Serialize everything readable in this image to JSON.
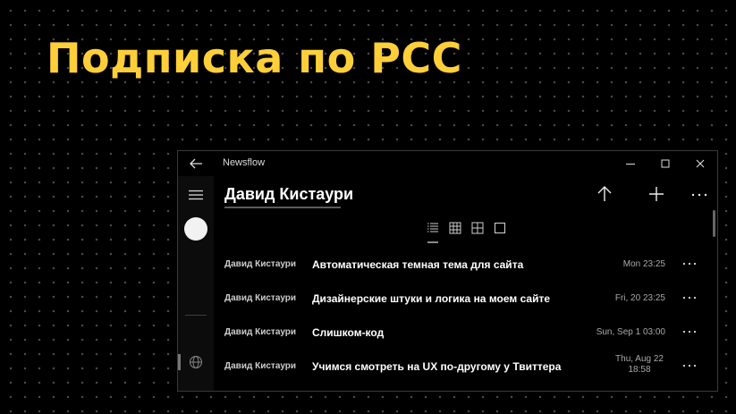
{
  "slide": {
    "headline": "Подписка по РСС"
  },
  "window": {
    "app_title": "Newsflow",
    "page_title": "Давид Кистаури",
    "rows": [
      {
        "author": "Давид Кистаури",
        "title": "Автоматическая темная тема для сайта",
        "date": "Mon 23:25"
      },
      {
        "author": "Давид Кистаури",
        "title": "Дизайнерские штуки и логика на моем сайте",
        "date": "Fri, 20 23:25"
      },
      {
        "author": "Давид Кистаури",
        "title": "Слишком-код",
        "date": "Sun, Sep 1 03:00"
      },
      {
        "author": "Давид Кистаури",
        "title": "Учимся смотреть на UX по-другому у Твиттера",
        "date": "Thu, Aug 22 18:58"
      }
    ]
  },
  "colors": {
    "headline": "#ffcf3a",
    "window_bg": "#000000",
    "text": "#ffffff",
    "muted": "#a8a8a8"
  },
  "icons": [
    "back-arrow-icon",
    "minimize-icon",
    "maximize-icon",
    "close-icon",
    "hamburger-icon",
    "globe-icon",
    "gear-icon",
    "arrow-up-icon",
    "plus-icon",
    "ellipsis-icon",
    "list-view-icon",
    "grid-small-icon",
    "grid-large-icon",
    "single-view-icon"
  ]
}
